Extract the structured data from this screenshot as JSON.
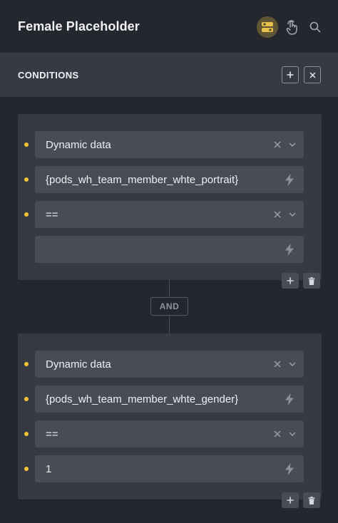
{
  "header": {
    "title": "Female Placeholder",
    "icons": [
      "toggle-icon",
      "hand-pointer-icon",
      "search-icon"
    ]
  },
  "conditions": {
    "title": "CONDITIONS",
    "actions": [
      "plus-icon",
      "close-icon"
    ]
  },
  "groups": [
    {
      "rows": [
        {
          "value": "Dynamic data",
          "type": "select"
        },
        {
          "value": "{pods_wh_team_member_whte_portrait}",
          "type": "dynamic-input"
        },
        {
          "value": "==",
          "type": "select"
        },
        {
          "value": "",
          "type": "dynamic-input"
        }
      ]
    },
    {
      "rows": [
        {
          "value": "Dynamic data",
          "type": "select"
        },
        {
          "value": "{pods_wh_team_member_whte_gender}",
          "type": "dynamic-input"
        },
        {
          "value": "==",
          "type": "select"
        },
        {
          "value": "1",
          "type": "dynamic-input"
        }
      ]
    }
  ],
  "connector": {
    "label": "AND"
  },
  "colors": {
    "accent_bullet": "#f5c43a",
    "toggle_bg": "#5f5534",
    "panel": "#363a42",
    "field": "#474c56",
    "background": "#24272d"
  }
}
